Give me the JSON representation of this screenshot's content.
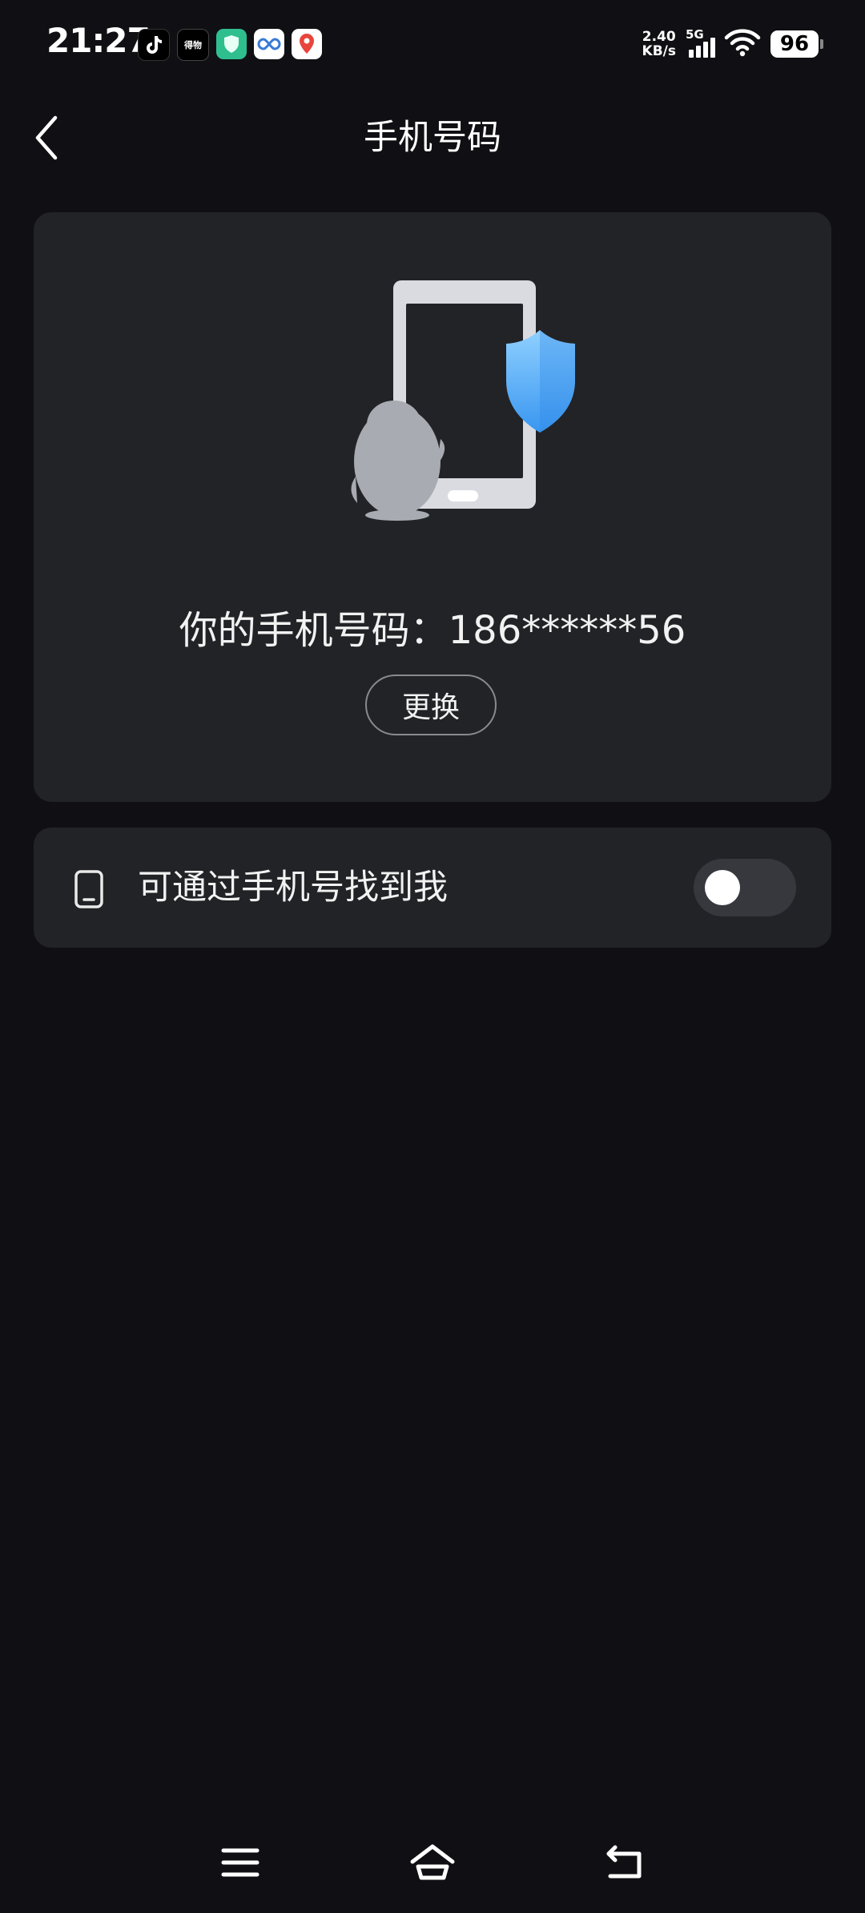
{
  "status_bar": {
    "time": "21:27",
    "notification_icons": [
      "tiktok-icon",
      "app-icon-black",
      "shield-app-icon",
      "infinity-app-icon",
      "map-pin-app-icon"
    ],
    "notif_black_label": "得物",
    "net_speed_value": "2.40",
    "net_speed_unit": "KB/s",
    "network_type": "5G",
    "battery": "96"
  },
  "header": {
    "title": "手机号码",
    "back_icon": "chevron-left-icon"
  },
  "phone_card": {
    "illustration": "phone-penguin-shield-illustration",
    "number_label": "你的手机号码：186******56",
    "change_button": "更换"
  },
  "find_card": {
    "icon": "phone-outline-icon",
    "label": "可通过手机号找到我",
    "toggle_on": false
  },
  "nav_bar": {
    "menu_icon": "menu-icon",
    "home_icon": "home-icon",
    "back_icon": "back-arrow-icon"
  },
  "colors": {
    "background": "#101014",
    "card": "#222326",
    "shield_blue": "#4aa8f5"
  }
}
